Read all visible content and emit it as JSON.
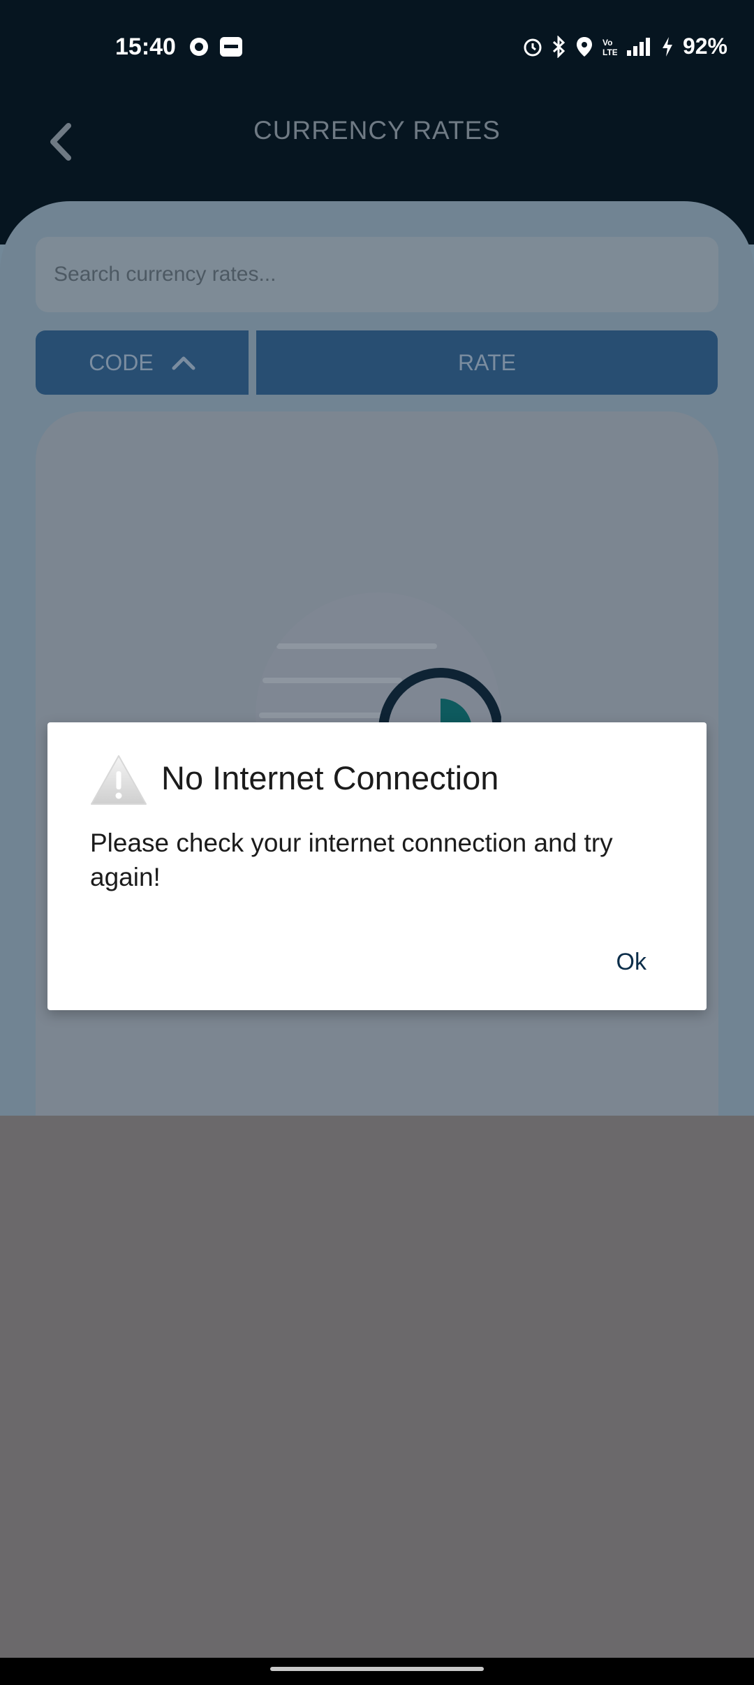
{
  "status_bar": {
    "time": "15:40",
    "battery": "92%",
    "left_icons": [
      "record-icon",
      "paytm-icon"
    ],
    "right_icons": [
      "alarm-icon",
      "bluetooth-icon",
      "location-icon",
      "volte-icon",
      "signal-icon",
      "charging-icon"
    ]
  },
  "header": {
    "title": "CURRENCY RATES",
    "back_icon": "chevron-left-icon"
  },
  "search": {
    "placeholder": "Search currency rates..."
  },
  "columns": {
    "code_label": "CODE",
    "code_sort_icon": "chevron-up-icon",
    "rate_label": "RATE"
  },
  "dialog": {
    "icon": "warning-icon",
    "title": "No Internet Connection",
    "message": "Please check your internet connection and try again!",
    "ok_label": "Ok"
  },
  "colors": {
    "header_bg": "#061520",
    "accent": "#284e72",
    "dialog_bg": "#ffffff",
    "scrim": "#6b696b"
  }
}
